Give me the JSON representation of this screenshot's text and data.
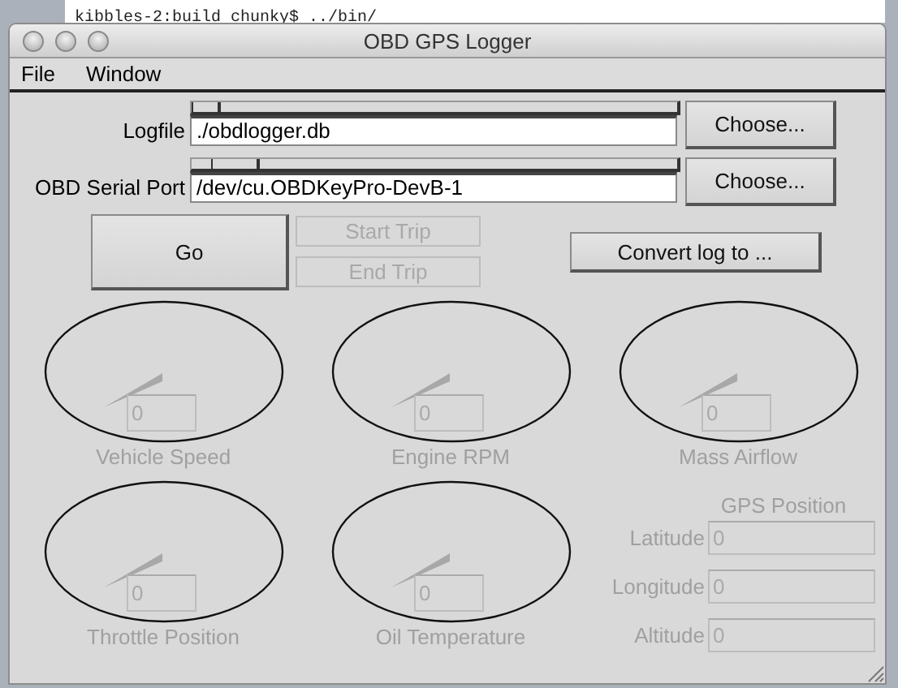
{
  "background_terminal": {
    "text": "kibbles-2:build chunky$ ../bin/"
  },
  "window": {
    "title": "OBD GPS Logger"
  },
  "menu": [
    {
      "label": "File"
    },
    {
      "label": "Window"
    }
  ],
  "file_rows": [
    {
      "label": "Logfile",
      "value": "./obdlogger.db",
      "button": "Choose..."
    },
    {
      "label": "OBD Serial Port",
      "value": "/dev/cu.OBDKeyPro-DevB-1",
      "button": "Choose..."
    }
  ],
  "actions": {
    "go": {
      "label": "Go",
      "disabled": false
    },
    "trip": [
      {
        "label": "Start Trip",
        "disabled": true
      },
      {
        "label": "End Trip",
        "disabled": true
      }
    ],
    "convert": {
      "label": "Convert log  to ...",
      "disabled": false
    }
  },
  "gauges": [
    {
      "label": "Vehicle Speed",
      "value": "0",
      "disabled": true
    },
    {
      "label": "Engine RPM",
      "value": "0",
      "disabled": true
    },
    {
      "label": "Mass Airflow",
      "value": "0",
      "disabled": true
    },
    {
      "label": "Throttle Position",
      "value": "0",
      "disabled": true
    },
    {
      "label": "Oil Temperature",
      "value": "0",
      "disabled": true
    }
  ],
  "gps": {
    "title": "GPS Position",
    "fields": [
      {
        "label": "Latitude",
        "value": "0",
        "disabled": true
      },
      {
        "label": "Longitude",
        "value": "0",
        "disabled": true
      },
      {
        "label": "Altitude",
        "value": "0",
        "disabled": true
      }
    ]
  }
}
